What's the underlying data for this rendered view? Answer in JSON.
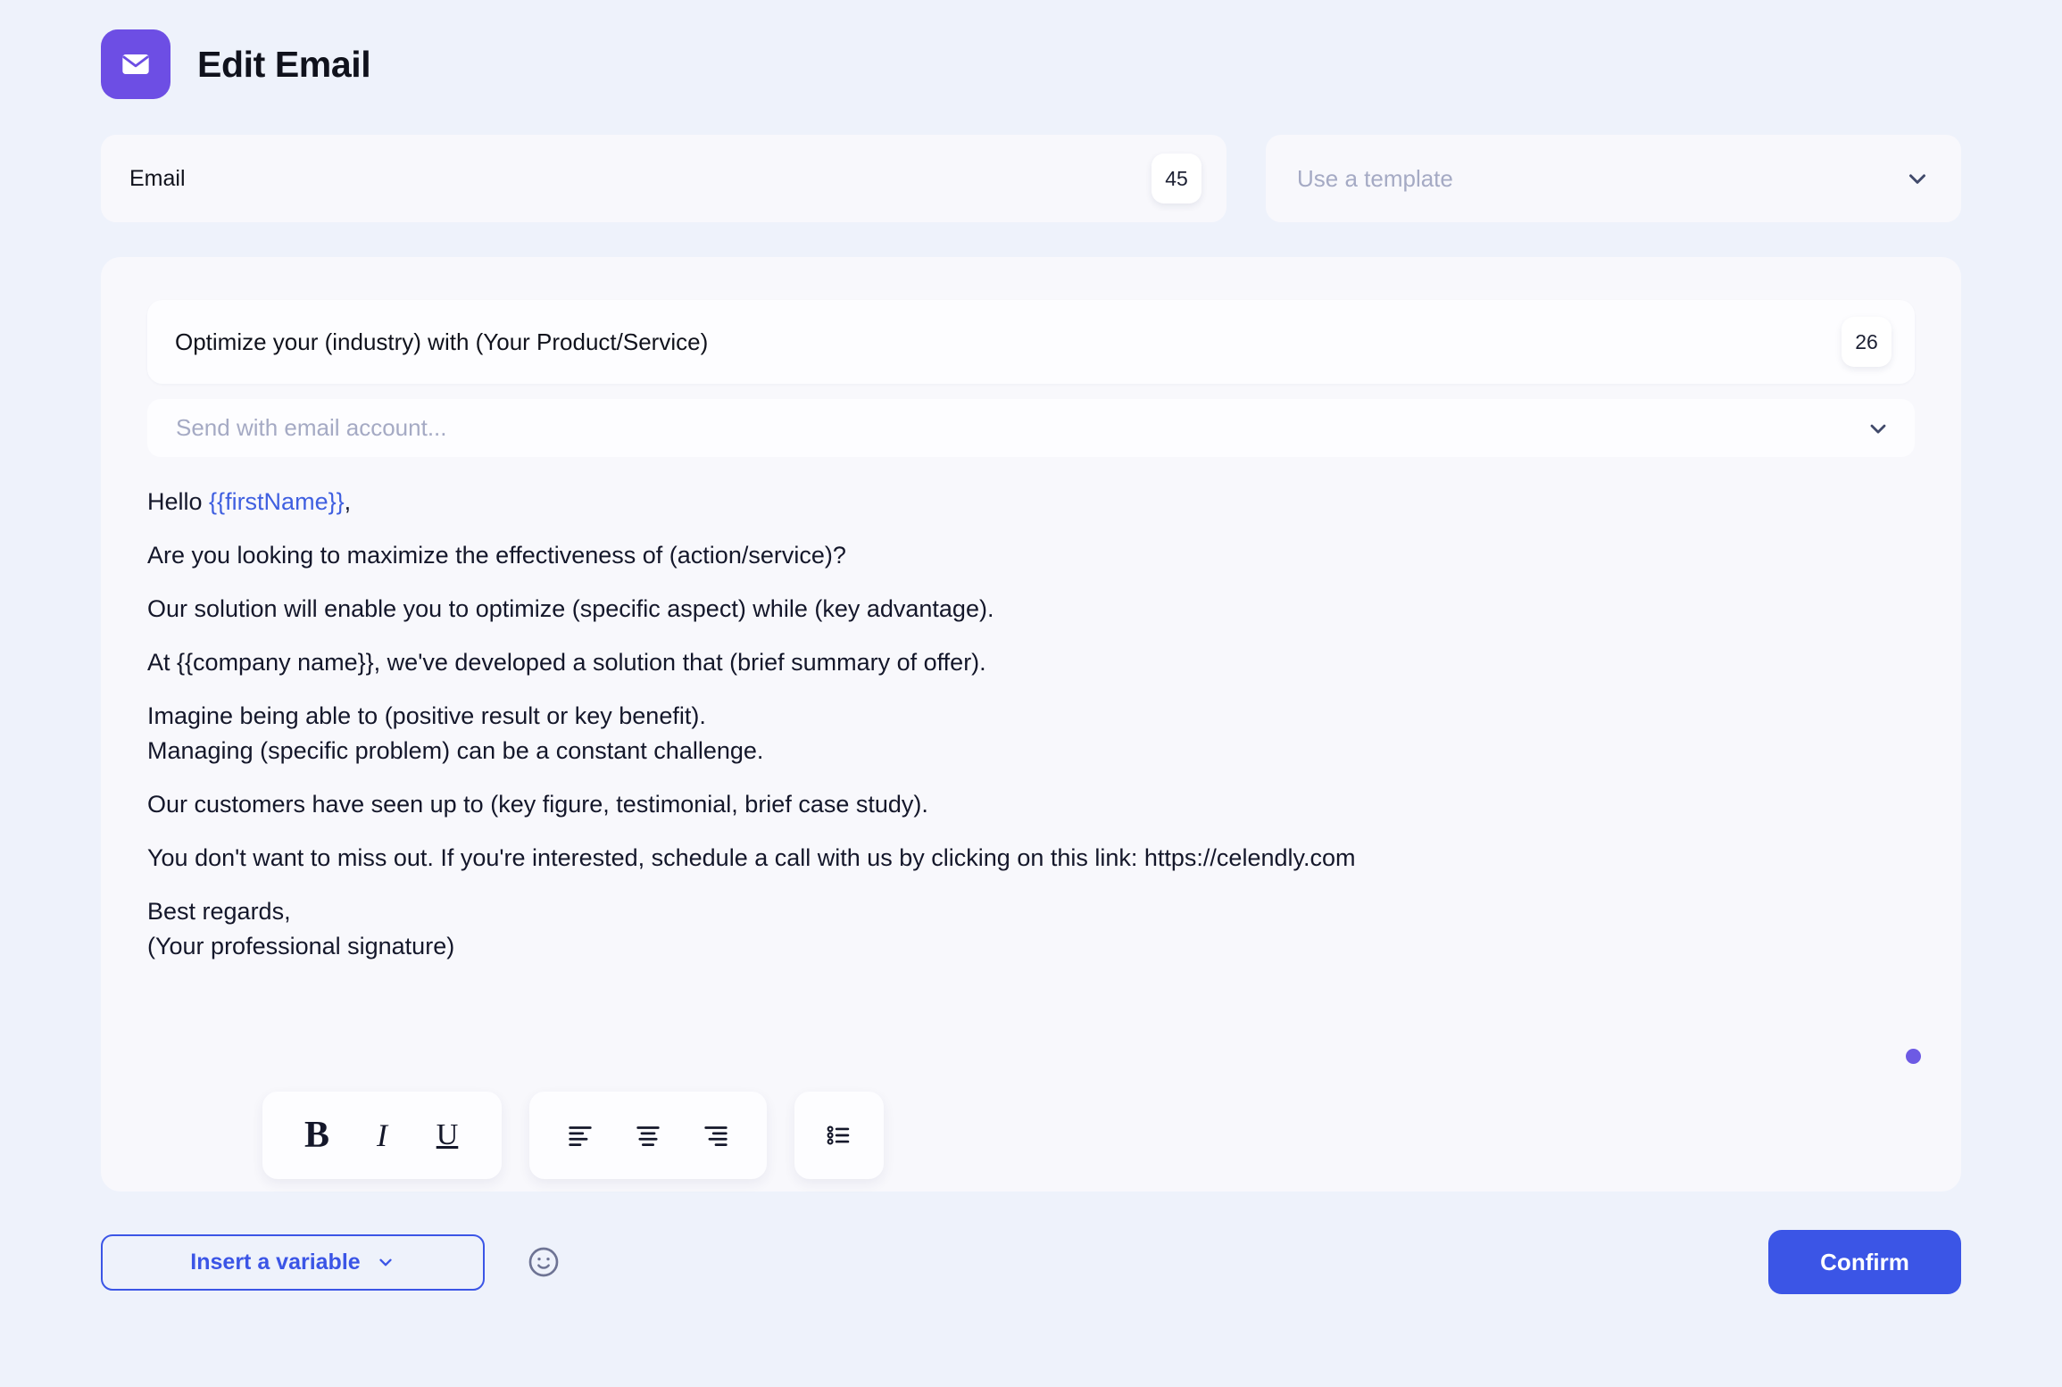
{
  "header": {
    "icon": "envelope-icon",
    "title": "Edit Email"
  },
  "colors": {
    "page_background": "#EEF2FB",
    "card_background": "#F8F8FC",
    "brand_purple": "#6D4EE4",
    "accent_blue": "#3B55E6",
    "variable_token_blue": "#3F5FE0",
    "text_primary": "#10121C",
    "placeholder": "#A5AAC4"
  },
  "top_row": {
    "email_name": {
      "value": "Email",
      "count_badge": "45"
    },
    "template_select": {
      "placeholder": "Use a template",
      "value": "",
      "chevron_icon": "chevron-down-icon"
    }
  },
  "editor": {
    "subject": {
      "value": "Optimize your (industry) with (Your Product/Service)",
      "count_badge": "26"
    },
    "account_select": {
      "placeholder": "Send with email account...",
      "value": "",
      "chevron_icon": "chevron-down-icon"
    },
    "body": {
      "greeting_prefix": "Hello ",
      "greeting_variable": "{{firstName}}",
      "greeting_suffix": ",",
      "paragraph_2": "Are you looking to maximize the effectiveness of (action/service)?",
      "paragraph_3": "Our solution will enable you to optimize (specific aspect) while (key advantage).",
      "paragraph_4": "At {{company name}}, we've developed a solution that (brief summary of offer).",
      "paragraph_5_line_1": "Imagine being able to (positive result or key benefit).",
      "paragraph_5_line_2": "Managing (specific problem) can be a constant challenge.",
      "paragraph_6": "Our customers have seen up to (key figure, testimonial, brief case study).",
      "paragraph_7": "You don't want to miss out. If you're interested, schedule a call with us by clicking on this link: https://celendly.com",
      "signature_line_1": "Best regards,",
      "signature_line_2": "(Your professional signature)"
    },
    "resize_handle": "resize-dot"
  },
  "format_toolbar": {
    "groups": [
      {
        "name": "text-style",
        "buttons": [
          {
            "name": "bold-button",
            "glyph": "B",
            "icon": "bold-icon"
          },
          {
            "name": "italic-button",
            "glyph": "I",
            "icon": "italic-icon"
          },
          {
            "name": "underline-button",
            "glyph": "U",
            "icon": "underline-icon"
          }
        ]
      },
      {
        "name": "alignment",
        "buttons": [
          {
            "name": "align-left-button",
            "icon": "align-left-icon"
          },
          {
            "name": "align-center-button",
            "icon": "align-center-icon"
          },
          {
            "name": "align-right-button",
            "icon": "align-right-icon"
          }
        ]
      },
      {
        "name": "list",
        "buttons": [
          {
            "name": "bullet-list-button",
            "icon": "bullet-list-icon"
          }
        ]
      }
    ]
  },
  "bottom_bar": {
    "insert_variable_label": "Insert a variable",
    "insert_variable_chevron": "chevron-down-icon",
    "emoji_icon": "smiley-face-icon",
    "confirm_label": "Confirm"
  }
}
